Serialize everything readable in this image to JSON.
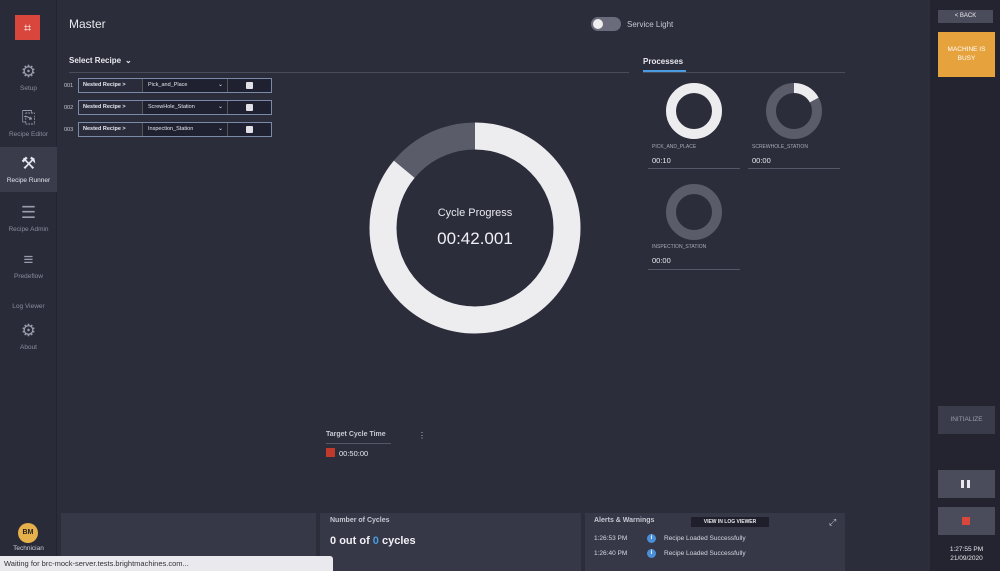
{
  "page": {
    "title": "Master"
  },
  "nav": {
    "items": [
      {
        "label": "Setup",
        "icon": "gear-icon"
      },
      {
        "label": "Recipe Editor",
        "icon": "recipe-editor-icon"
      },
      {
        "label": "Recipe Runner",
        "icon": "robot-arm-icon",
        "active": true
      },
      {
        "label": "Recipe Admin",
        "icon": "list-icon"
      },
      {
        "label": "Predeflow",
        "icon": "lines-icon"
      },
      {
        "label": "Log Viewer",
        "icon": ""
      },
      {
        "label": "About",
        "icon": "gear-icon"
      }
    ],
    "user": {
      "initials": "BM",
      "role": "Technician"
    }
  },
  "service_light": {
    "label": "Service Light",
    "on": false
  },
  "select_recipe": {
    "label": "Select Recipe",
    "rows": [
      {
        "num": "001",
        "nested": "Nested Recipe",
        "recipe": "Pick_and_Place"
      },
      {
        "num": "002",
        "nested": "Nested Recipe",
        "recipe": "ScrewHole_Station"
      },
      {
        "num": "003",
        "nested": "Nested Recipe",
        "recipe": "Inspection_Station"
      }
    ]
  },
  "cycle": {
    "label": "Cycle Progress",
    "time": "00:42.001",
    "progress": 0.86
  },
  "processes": {
    "title": "Processes",
    "items": [
      {
        "name": "PICK_AND_PLACE",
        "time": "00:10",
        "progress": 1.0
      },
      {
        "name": "SCREWHOLE_STATION",
        "time": "00:00",
        "progress": 0.17
      },
      {
        "name": "INSPECTION_STATION",
        "time": "00:00",
        "progress": 0.0
      }
    ]
  },
  "target_cycle": {
    "label": "Target Cycle Time",
    "value": "00:50:00"
  },
  "cycles": {
    "label": "Number of Cycles",
    "done": "0",
    "total": "0",
    "pre": "out of",
    "post": "cycles"
  },
  "alerts": {
    "title": "Alerts & Warnings",
    "log_button": "VIEW IN LOG VIEWER",
    "rows": [
      {
        "time": "1:26:53 PM",
        "msg": "Recipe Loaded Successfully"
      },
      {
        "time": "1:26:40 PM",
        "msg": "Recipe Loaded Successfully"
      }
    ]
  },
  "status_bar": "Waiting for brc-mock-server.tests.brightmachines.com...",
  "right": {
    "back": "< BACK",
    "busy": "MACHINE IS BUSY",
    "initialize": "INITIALIZE",
    "time": "1:27:55 PM",
    "date": "21/09/2020"
  },
  "colors": {
    "accent": "#4a9be0",
    "busy": "#e6a23c",
    "stop": "#d9473c",
    "ring": "#ededf0",
    "ring_track": "#5a5c6a"
  }
}
